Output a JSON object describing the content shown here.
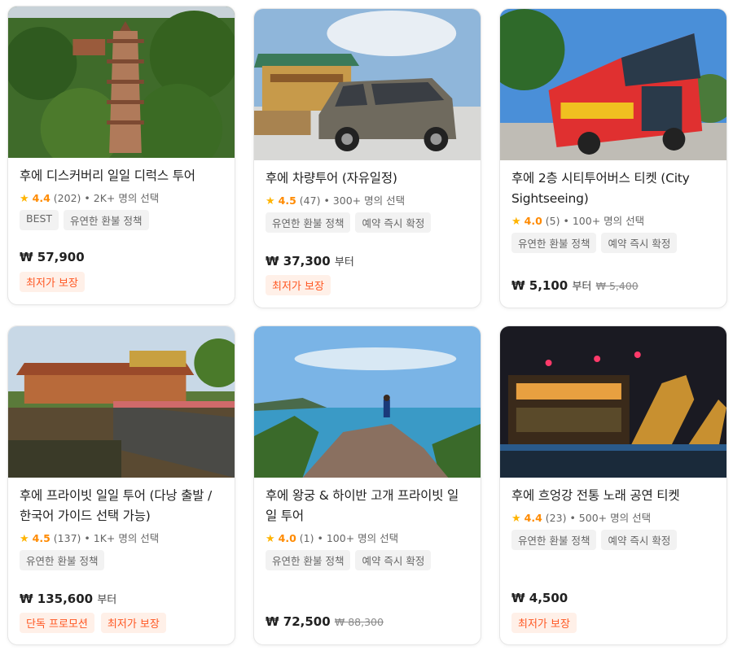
{
  "cards": [
    {
      "title": "후에 디스커버리 일일 디럭스 투어",
      "star": "★",
      "rating": "4.4",
      "reviews": "(202)",
      "booked": "• 2K+ 명의 선택",
      "tags": [
        "BEST",
        "유연한 환불 정책"
      ],
      "price": "₩ 57,900",
      "price_suffix": "",
      "price_strike": "",
      "promos": [
        "최저가 보장"
      ]
    },
    {
      "title": "후에 차량투어 (자유일정)",
      "star": "★",
      "rating": "4.5",
      "reviews": "(47)",
      "booked": "• 300+ 명의 선택",
      "tags": [
        "유연한 환불 정책",
        "예약 즉시 확정"
      ],
      "price": "₩ 37,300",
      "price_suffix": "부터",
      "price_strike": "",
      "promos": [
        "최저가 보장"
      ]
    },
    {
      "title": "후에 2층 시티투어버스 티켓 (City Sightseeing)",
      "star": "★",
      "rating": "4.0",
      "reviews": "(5)",
      "booked": "• 100+ 명의 선택",
      "tags": [
        "유연한 환불 정책",
        "예약 즉시 확정"
      ],
      "price": "₩ 5,100",
      "price_suffix": "부터",
      "price_strike": "₩ 5,400",
      "promos": []
    },
    {
      "title": "후에 프라이빗 일일 투어 (다낭 출발 / 한국어 가이드 선택 가능)",
      "star": "★",
      "rating": "4.5",
      "reviews": "(137)",
      "booked": "• 1K+ 명의 선택",
      "tags": [
        "유연한 환불 정책"
      ],
      "price": "₩ 135,600",
      "price_suffix": "부터",
      "price_strike": "",
      "promos": [
        "단독 프로모션",
        "최저가 보장"
      ]
    },
    {
      "title": "후에 왕궁 & 하이반 고개 프라이빗 일일 투어",
      "star": "★",
      "rating": "4.0",
      "reviews": "(1)",
      "booked": "• 100+ 명의 선택",
      "tags": [
        "유연한 환불 정책",
        "예약 즉시 확정"
      ],
      "price": "₩ 72,500",
      "price_suffix": "",
      "price_strike": "₩ 88,300",
      "promos": []
    },
    {
      "title": "후에 흐엉강 전통 노래 공연 티켓",
      "star": "★",
      "rating": "4.4",
      "reviews": "(23)",
      "booked": "• 500+ 명의 선택",
      "tags": [
        "유연한 환불 정책",
        "예약 즉시 확정"
      ],
      "price": "₩ 4,500",
      "price_suffix": "",
      "price_strike": "",
      "promos": [
        "최저가 보장"
      ]
    }
  ],
  "colors": {
    "rating": "#ff8a00",
    "star": "#ffb400",
    "promo_text": "#ff5722",
    "promo_bg": "#fff0e8",
    "tag_bg": "#f2f2f2"
  }
}
